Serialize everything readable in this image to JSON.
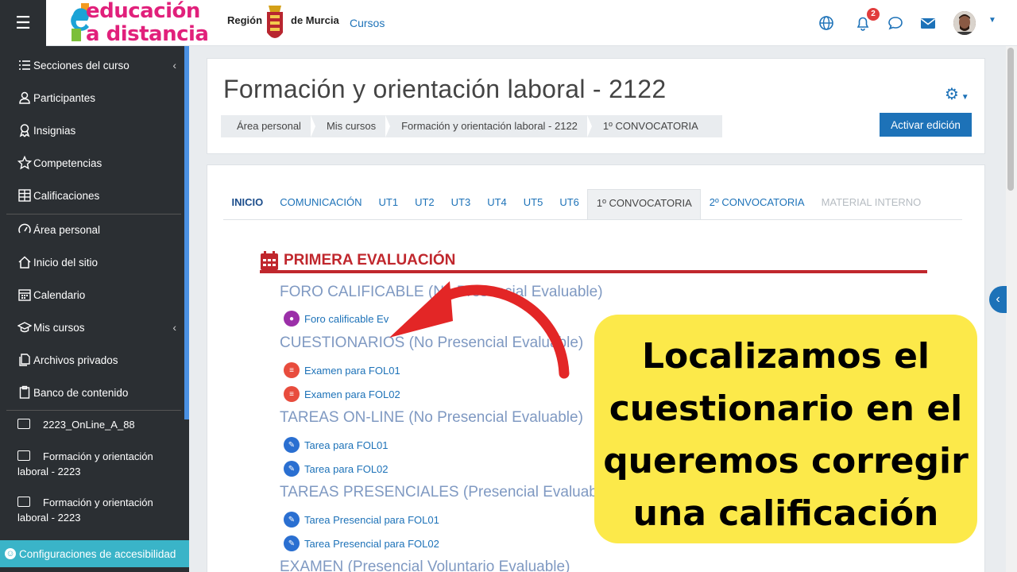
{
  "navbar": {
    "logo_line1": "educación",
    "logo_line2": "a distancia",
    "region_label": "Región",
    "murcia_label": "de Murcia",
    "cursos_link": "Cursos",
    "notification_count": "2",
    "icons": [
      "menu-icon",
      "globe-icon",
      "bell-icon",
      "chat-icon",
      "envelope-icon",
      "user-avatar"
    ]
  },
  "sidebar": {
    "items": [
      {
        "label": "Secciones del curso",
        "icon": "list-icon",
        "caret": "‹"
      },
      {
        "label": "Participantes",
        "icon": "users-icon"
      },
      {
        "label": "Insignias",
        "icon": "badge-icon"
      },
      {
        "label": "Competencias",
        "icon": "star-icon"
      },
      {
        "label": "Calificaciones",
        "icon": "table-icon"
      },
      {
        "label": "Área personal",
        "icon": "dashboard-icon"
      },
      {
        "label": "Inicio del sitio",
        "icon": "home-icon"
      },
      {
        "label": "Calendario",
        "icon": "calendar-icon"
      },
      {
        "label": "Mis cursos",
        "icon": "graduation-icon",
        "caret": "‹"
      },
      {
        "label": "Archivos privados",
        "icon": "files-icon"
      },
      {
        "label": "Banco de contenido",
        "icon": "clipboard-icon"
      }
    ],
    "folders": [
      {
        "label": "2223_OnLine_A_88"
      },
      {
        "label_line1": "Formación y orientación",
        "label_line2": "laboral - 2223"
      },
      {
        "label_line1": "Formación y orientación",
        "label_line2": "laboral - 2223"
      }
    ],
    "accessibility_label": "Configuraciones de accesibilidad"
  },
  "header": {
    "title": "Formación y orientación laboral - 2122",
    "breadcrumb": [
      "Área personal",
      "Mis cursos",
      "Formación y orientación laboral - 2122",
      "1º CONVOCATORIA"
    ],
    "edit_button": "Activar edición"
  },
  "tabs": [
    {
      "label": "INICIO",
      "state": "home"
    },
    {
      "label": "COMUNICACIÓN",
      "state": "normal"
    },
    {
      "label": "UT1",
      "state": "normal"
    },
    {
      "label": "UT2",
      "state": "normal"
    },
    {
      "label": "UT3",
      "state": "normal"
    },
    {
      "label": "UT4",
      "state": "normal"
    },
    {
      "label": "UT5",
      "state": "normal"
    },
    {
      "label": "UT6",
      "state": "normal"
    },
    {
      "label": "1º CONVOCATORIA",
      "state": "selected"
    },
    {
      "label": "2º CONVOCATORIA",
      "state": "normal"
    },
    {
      "label": "MATERIAL INTERNO",
      "state": "disabled"
    }
  ],
  "section": {
    "title": "PRIMERA EVALUACIÓN",
    "groups": [
      {
        "title": "FORO CALIFICABLE (No Presencial Evaluable)",
        "activities": [
          {
            "label": "Foro calificable Ev",
            "type": "forum"
          }
        ]
      },
      {
        "title": "CUESTIONARIOS (No Presencial Evaluable)",
        "activities": [
          {
            "label": "Examen para FOL01",
            "type": "quiz"
          },
          {
            "label": "Examen para FOL02",
            "type": "quiz"
          }
        ]
      },
      {
        "title": "TAREAS ON-LINE (No Presencial Evaluable)",
        "activities": [
          {
            "label": "Tarea para FOL01",
            "type": "assign"
          },
          {
            "label": "Tarea para FOL02",
            "type": "assign"
          }
        ]
      },
      {
        "title": "TAREAS PRESENCIALES (Presencial Evaluable)",
        "activities": [
          {
            "label": "Tarea Presencial para FOL01",
            "type": "assign"
          },
          {
            "label": "Tarea Presencial para FOL02",
            "type": "assign"
          }
        ]
      },
      {
        "title": "EXAMEN (Presencial Voluntario Evaluable)",
        "activities": []
      }
    ]
  },
  "overlay": {
    "callout_lines": [
      "Localizamos el",
      "cuestionario en el",
      "queremos corregir",
      "una calificación"
    ],
    "callout_color": "#fce94a",
    "arrow_color": "#e32626"
  },
  "colors": {
    "sidebar_bg": "#2b2f33",
    "link_blue": "#1d72b8",
    "section_red": "#c0272d",
    "accessibility_bar": "#3ab4c8"
  }
}
